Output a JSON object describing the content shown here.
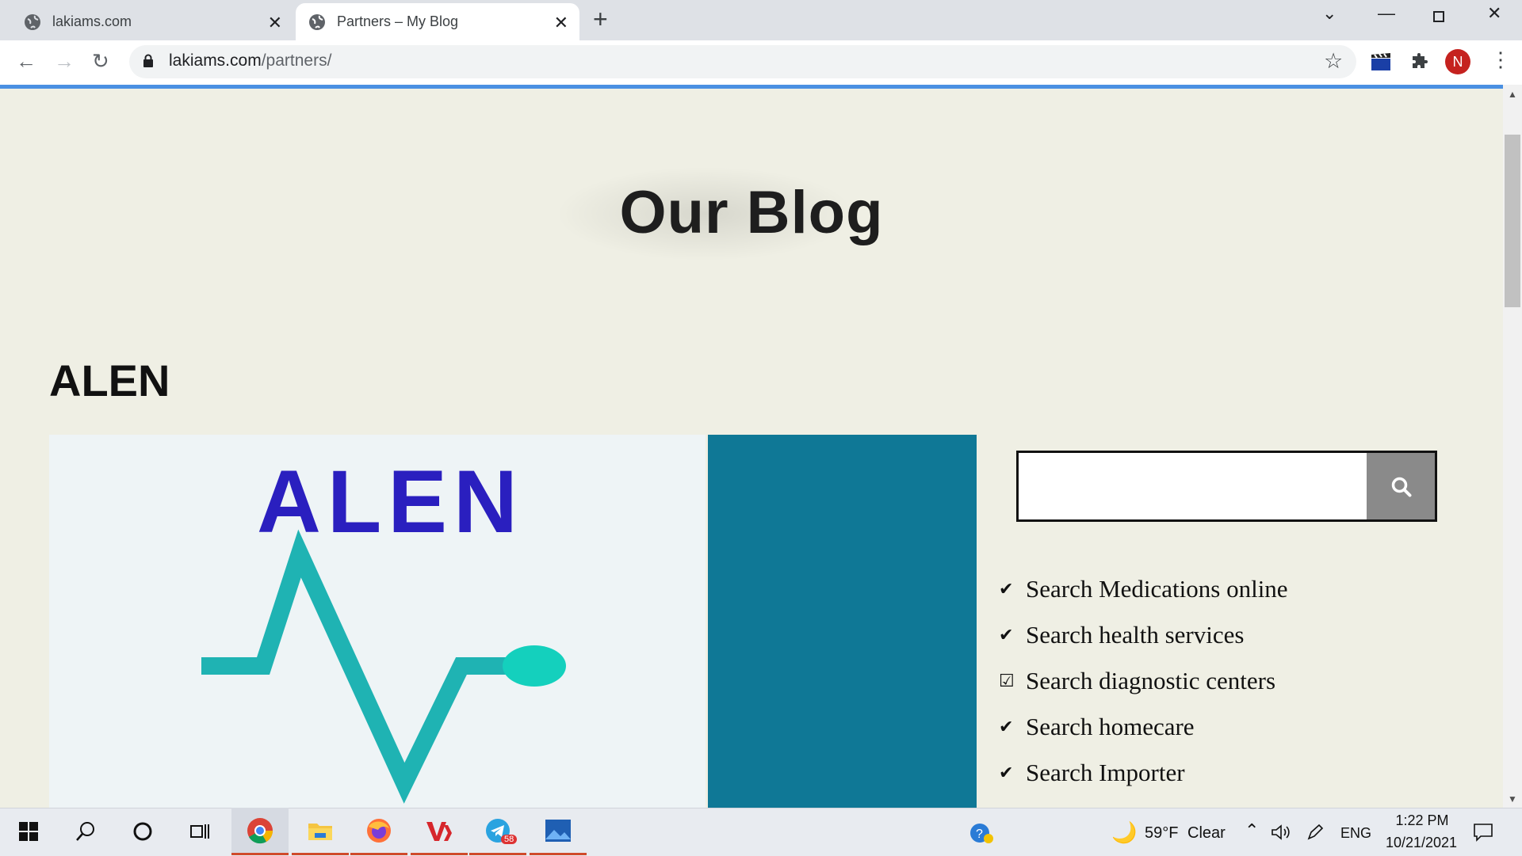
{
  "browser": {
    "tabs": [
      {
        "title": "lakiams.com",
        "active": false
      },
      {
        "title": "Partners – My Blog",
        "active": true
      }
    ],
    "url_host": "lakiams.com",
    "url_path": "/partners/",
    "avatar_letter": "N",
    "colors": {
      "accent": "#4a90e2",
      "avatar": "#c5221f"
    }
  },
  "page": {
    "title": "Our Blog",
    "post_heading": "ALEN",
    "post_image_logo": "ALEN",
    "colors": {
      "background": "#efefe4",
      "teal_block": "#0f7896",
      "logo_blue": "#2a1fbf",
      "logo_teal": "#1fb3b3"
    },
    "search": {
      "placeholder": "",
      "button_icon": "search-icon"
    },
    "features": [
      {
        "label": "Search Medications online",
        "icon": "check-icon"
      },
      {
        "label": "Search health services",
        "icon": "check-icon"
      },
      {
        "label": "Search diagnostic centers",
        "icon": "checkbox-icon"
      },
      {
        "label": "Search homecare",
        "icon": "check-icon"
      },
      {
        "label": "Search Importer",
        "icon": "check-icon"
      }
    ]
  },
  "taskbar": {
    "apps": [
      "start",
      "search",
      "cortana",
      "task-view",
      "chrome",
      "file-explorer",
      "firefox",
      "vk",
      "telegram",
      "photos"
    ],
    "telegram_badge": "58",
    "weather": {
      "temp": "59°F",
      "condition": "Clear"
    },
    "language": "ENG",
    "time": "1:22 PM",
    "date": "10/21/2021"
  }
}
